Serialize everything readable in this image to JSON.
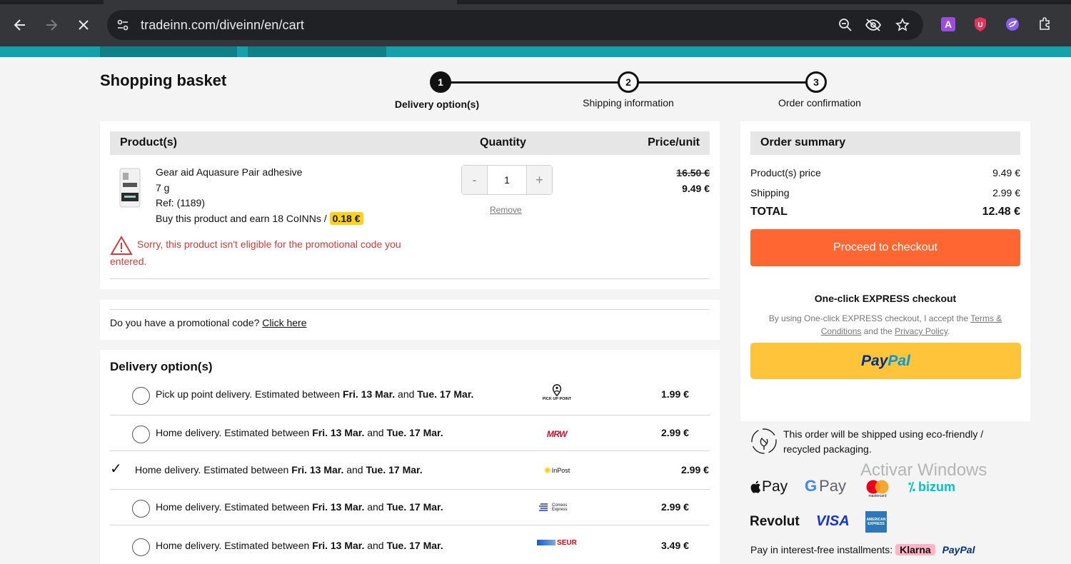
{
  "browser": {
    "url": "tradeinn.com/diveinn/en/cart"
  },
  "page": {
    "title": "Shopping basket"
  },
  "stepper": {
    "steps": [
      {
        "number": "1",
        "label": "Delivery option(s)"
      },
      {
        "number": "2",
        "label": "Shipping information"
      },
      {
        "number": "3",
        "label": "Order confirmation"
      }
    ]
  },
  "basket": {
    "headers": {
      "product": "Product(s)",
      "quantity": "Quantity",
      "price": "Price/unit"
    },
    "item": {
      "name": "Gear aid Aquasure Pair adhesive",
      "size": "7 g",
      "ref": "Ref: (1189)",
      "earn_text": "Buy this product and earn 18 CoINNs / ",
      "earn_value": "0.18 €",
      "quantity": "1",
      "qty_minus": "-",
      "qty_plus": "+",
      "remove": "Remove",
      "old_price": "16.50 €",
      "price": "9.49 €",
      "warning": "Sorry, this product isn't eligible for the promotional code you entered."
    }
  },
  "promo": {
    "question": "Do you have a promotional code? ",
    "link": "Click here"
  },
  "delivery": {
    "title": "Delivery option(s)",
    "options": [
      {
        "prefix": "Pick up point delivery. Estimated between ",
        "from": "Fri. 13 Mar.",
        "mid": " and ",
        "to": "Tue. 17 Mar.",
        "carrier": "PICK UP POINT",
        "price": "1.99 €",
        "selected": false
      },
      {
        "prefix": "Home delivery. Estimated between ",
        "from": "Fri. 13 Mar.",
        "mid": " and ",
        "to": "Tue. 17 Mar.",
        "carrier": "MRW",
        "price": "2.99 €",
        "selected": false
      },
      {
        "prefix": "Home delivery. Estimated between ",
        "from": "Fri. 13 Mar.",
        "mid": " and ",
        "to": "Tue. 17 Mar.",
        "carrier": "InPost",
        "price": "2.99 €",
        "selected": true
      },
      {
        "prefix": "Home delivery. Estimated between ",
        "from": "Fri. 13 Mar.",
        "mid": " and ",
        "to": "Tue. 17 Mar.",
        "carrier": "Correos Express",
        "price": "2.99 €",
        "selected": false
      },
      {
        "prefix": "Home delivery. Estimated between ",
        "from": "Fri. 13 Mar.",
        "mid": " and ",
        "to": "Tue. 17 Mar.",
        "carrier": "SEUR",
        "price": "3.49 €",
        "selected": false
      }
    ]
  },
  "summary": {
    "title": "Order summary",
    "products_label": "Product(s) price",
    "products_value": "9.49 €",
    "shipping_label": "Shipping",
    "shipping_value": "2.99 €",
    "total_label": "TOTAL",
    "total_value": "12.48 €",
    "checkout_button": "Proceed to checkout",
    "express_title": "One-click EXPRESS checkout",
    "express_terms_prefix": "By using One-click EXPRESS checkout, I accept the ",
    "terms_link": "Terms & Conditions",
    "express_terms_mid": " and the ",
    "privacy_link": "Privacy Policy",
    "express_terms_suffix": ".",
    "paypal_pay": "Pay",
    "paypal_pal": "Pal",
    "eco_text": "This order will be shipped using eco-friendly / recycled packaging.",
    "payment_methods": {
      "apple_pay": "Pay",
      "google_pay": "Pay",
      "mastercard": "mastercard",
      "bizum": "bizum",
      "revolut": "Revolut",
      "visa": "VISA",
      "amex": "AMERICAN EXPRESS"
    },
    "installments_text": "Pay in interest-free installments:",
    "klarna": "Klarna",
    "installments_paypal": "PayPal"
  },
  "watermark": "Activar Windows",
  "colors": {
    "accent_orange": "#ff6632",
    "teal": "#14a1ac",
    "paypal_yellow": "#ffc439",
    "warning_red": "#d83a3a",
    "coin_yellow": "#ffd21a"
  }
}
